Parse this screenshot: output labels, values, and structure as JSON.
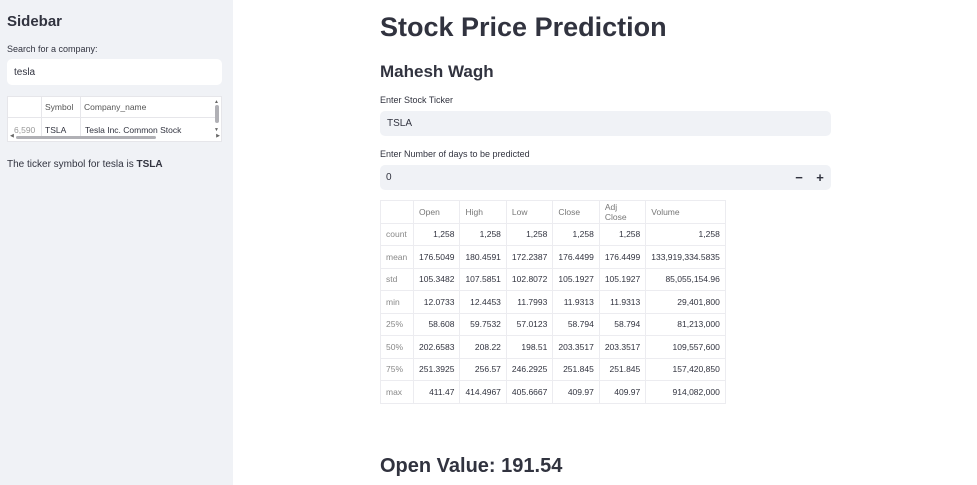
{
  "sidebar": {
    "title": "Sidebar",
    "search_label": "Search for a company:",
    "search_value": "tesla",
    "table": {
      "columns": [
        "",
        "Symbol",
        "Company_name"
      ],
      "rows": [
        [
          "6,590",
          "TSLA",
          "Tesla Inc. Common Stock"
        ]
      ]
    },
    "result_prefix": "The ticker symbol for tesla is",
    "result_symbol": "TSLA"
  },
  "main": {
    "title": "Stock Price Prediction",
    "subtitle": "Mahesh Wagh",
    "ticker_label": "Enter Stock Ticker",
    "ticker_value": "TSLA",
    "days_label": "Enter Number of days to be predicted",
    "days_value": "0",
    "minus_label": "−",
    "plus_label": "+",
    "open_value_text": "Open Value: 191.54"
  },
  "stats_table": {
    "columns": [
      "",
      "Open",
      "High",
      "Low",
      "Close",
      "Adj Close",
      "Volume"
    ],
    "rows": [
      [
        "count",
        "1,258",
        "1,258",
        "1,258",
        "1,258",
        "1,258",
        "1,258"
      ],
      [
        "mean",
        "176.5049",
        "180.4591",
        "172.2387",
        "176.4499",
        "176.4499",
        "133,919,334.5835"
      ],
      [
        "std",
        "105.3482",
        "107.5851",
        "102.8072",
        "105.1927",
        "105.1927",
        "85,055,154.96"
      ],
      [
        "min",
        "12.0733",
        "12.4453",
        "11.7993",
        "11.9313",
        "11.9313",
        "29,401,800"
      ],
      [
        "25%",
        "58.608",
        "59.7532",
        "57.0123",
        "58.794",
        "58.794",
        "81,213,000"
      ],
      [
        "50%",
        "202.6583",
        "208.22",
        "198.51",
        "203.3517",
        "203.3517",
        "109,557,600"
      ],
      [
        "75%",
        "251.3925",
        "256.57",
        "246.2925",
        "251.845",
        "251.845",
        "157,420,850"
      ],
      [
        "max",
        "411.47",
        "414.4967",
        "405.6667",
        "409.97",
        "409.97",
        "914,082,000"
      ]
    ]
  }
}
